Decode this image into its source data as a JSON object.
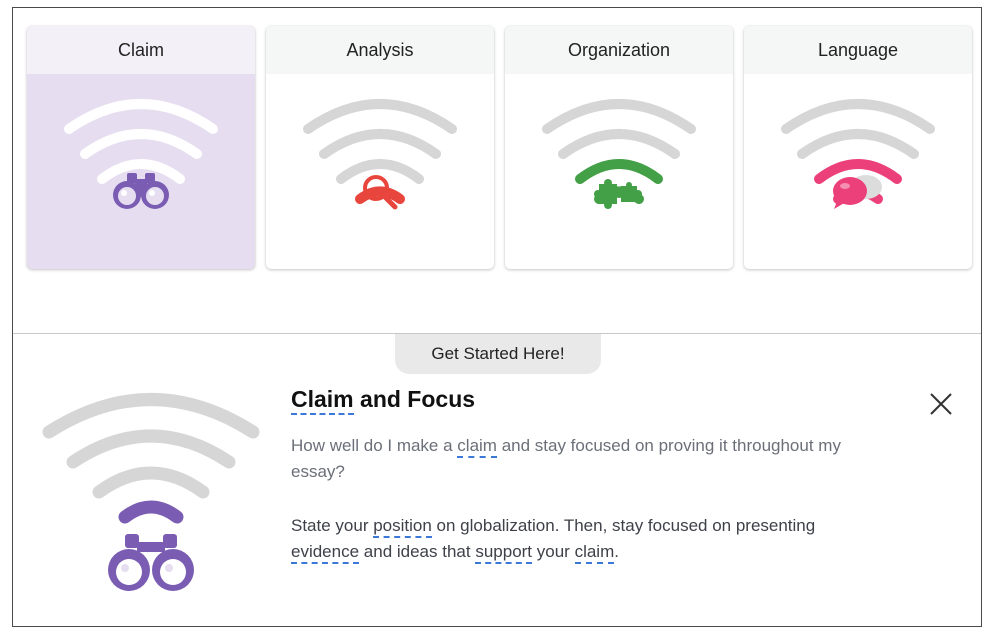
{
  "cards": [
    {
      "title": "Claim",
      "icon": "binoculars-icon",
      "accent": "#7a5db3",
      "selected": true
    },
    {
      "title": "Analysis",
      "icon": "magnifier-icon",
      "accent": "#e8463c",
      "selected": false
    },
    {
      "title": "Organization",
      "icon": "puzzle-icon",
      "accent": "#43a047",
      "selected": false
    },
    {
      "title": "Language",
      "icon": "speech-bubbles-icon",
      "accent": "#ec407a",
      "selected": false
    }
  ],
  "get_started_label": "Get Started Here!",
  "detail": {
    "title_term": "Claim",
    "title_rest": " and Focus",
    "question": {
      "pre": "How well do I make a ",
      "term": "claim",
      "post": " and stay focused on proving it throughout my essay?"
    },
    "description": {
      "p1": "State your ",
      "t1": "position",
      "p2": " on globalization. Then, stay focused on presenting ",
      "t2": "evidence",
      "p3": " and ideas that ",
      "t3": "support",
      "p4": " your ",
      "t4": "claim",
      "p5": "."
    }
  },
  "colors": {
    "signal_inactive": "#d6d6d6",
    "signal_inactive_selected": "#ffffff",
    "term_underline": "#3b78d8"
  }
}
